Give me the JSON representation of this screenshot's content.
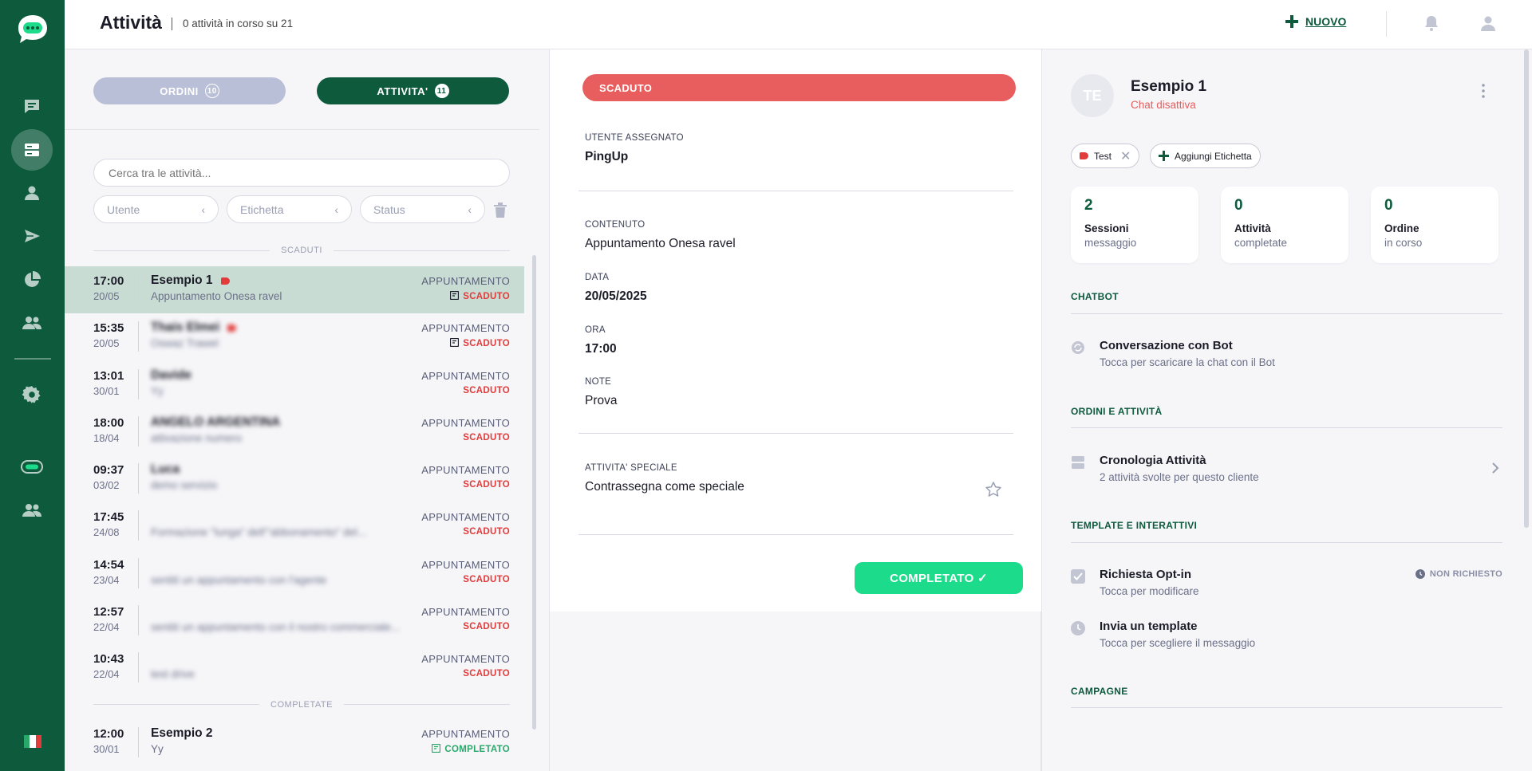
{
  "header": {
    "title": "Attività",
    "subtitle": "0 attività in corso su 21",
    "new_label": "NUOVO"
  },
  "sidebar": {
    "items": [
      {
        "icon": "chat-icon"
      },
      {
        "icon": "list-icon",
        "active": true
      },
      {
        "icon": "user-icon"
      },
      {
        "icon": "send-icon"
      },
      {
        "icon": "pie-chart-icon"
      },
      {
        "icon": "users-icon"
      },
      {
        "icon": "settings-icon"
      },
      {
        "icon": "chatbot-icon"
      },
      {
        "icon": "team-icon"
      }
    ],
    "flag": "italy-flag"
  },
  "left": {
    "tabs": {
      "orders_label": "ORDINI",
      "orders_count": "10",
      "activities_label": "ATTIVITA'",
      "activities_count": "11"
    },
    "search_placeholder": "Cerca tra le attività...",
    "filters": {
      "user": "Utente",
      "label": "Etichetta",
      "status": "Status"
    },
    "section_expired": "SCADUTI",
    "section_completed": "COMPLETATE",
    "expired_rows": [
      {
        "time": "17:00",
        "date": "20/05",
        "name": "Esempio 1",
        "desc": "Appuntamento Onesa ravel",
        "type": "APPUNTAMENTO",
        "status": "SCADUTO",
        "has_tag": true,
        "has_note": true,
        "blurred": false
      },
      {
        "time": "15:35",
        "date": "20/05",
        "name": "Thais Elmei",
        "desc": "Oswaz Trawel",
        "type": "APPUNTAMENTO",
        "status": "SCADUTO",
        "has_tag": true,
        "has_note": true,
        "blurred": true
      },
      {
        "time": "13:01",
        "date": "30/01",
        "name": "Davide",
        "desc": "Yy",
        "type": "APPUNTAMENTO",
        "status": "SCADUTO",
        "has_tag": false,
        "has_note": false,
        "blurred": true
      },
      {
        "time": "18:00",
        "date": "18/04",
        "name": "ANGELO ARGENTINA",
        "desc": "attivazione numero",
        "type": "APPUNTAMENTO",
        "status": "SCADUTO",
        "has_tag": false,
        "has_note": false,
        "blurred": true
      },
      {
        "time": "09:37",
        "date": "03/02",
        "name": "Luca",
        "desc": "demo servizio",
        "type": "APPUNTAMENTO",
        "status": "SCADUTO",
        "has_tag": false,
        "has_note": false,
        "blurred": true
      },
      {
        "time": "17:45",
        "date": "24/08",
        "name": "",
        "desc": "Formazione \"lunga\" dell'\"abbonamento\" del...",
        "type": "APPUNTAMENTO",
        "status": "SCADUTO",
        "has_tag": false,
        "has_note": false,
        "blurred": true
      },
      {
        "time": "14:54",
        "date": "23/04",
        "name": "",
        "desc": "sentiti un appuntamento con l'agente",
        "type": "APPUNTAMENTO",
        "status": "SCADUTO",
        "has_tag": false,
        "has_note": false,
        "blurred": true
      },
      {
        "time": "12:57",
        "date": "22/04",
        "name": "",
        "desc": "sentiti un appuntamento con il nostro commerciale...",
        "type": "APPUNTAMENTO",
        "status": "SCADUTO",
        "has_tag": false,
        "has_note": false,
        "blurred": true
      },
      {
        "time": "10:43",
        "date": "22/04",
        "name": "",
        "desc": "test drive",
        "type": "APPUNTAMENTO",
        "status": "SCADUTO",
        "has_tag": false,
        "has_note": false,
        "blurred": true
      }
    ],
    "completed_rows": [
      {
        "time": "12:00",
        "date": "30/01",
        "name": "Esempio 2",
        "desc": "Yy",
        "type": "APPUNTAMENTO",
        "status": "COMPLETATO",
        "has_note": true
      }
    ]
  },
  "detail": {
    "status_bar": "SCADUTO",
    "assigned_label": "UTENTE ASSEGNATO",
    "assigned_value": "PingUp",
    "content_label": "CONTENUTO",
    "content_value": "Appuntamento Onesa ravel",
    "date_label": "DATA",
    "date_value": "20/05/2025",
    "time_label": "ORA",
    "time_value": "17:00",
    "notes_label": "NOTE",
    "notes_value": "Prova",
    "special_label": "ATTIVITA' SPECIALE",
    "special_value": "Contrassegna come speciale",
    "complete_label": "COMPLETATO ✓"
  },
  "customer": {
    "initials": "TE",
    "name": "Esempio 1",
    "chat_status": "Chat disattiva",
    "tag_label": "Test",
    "add_tag_label": "Aggiungi Etichetta",
    "stats": [
      {
        "num": "2",
        "l1": "Sessioni",
        "l2": "messaggio"
      },
      {
        "num": "0",
        "l1": "Attività",
        "l2": "completate"
      },
      {
        "num": "0",
        "l1": "Ordine",
        "l2": "in corso"
      }
    ],
    "sections": {
      "chatbot": "CHATBOT",
      "orders": "ORDINI E ATTIVITÀ",
      "templates": "TEMPLATE E INTERATTIVI",
      "campaigns": "CAMPAGNE"
    },
    "bot_title": "Conversazione con Bot",
    "bot_sub": "Tocca per scaricare la chat con il Bot",
    "history_title": "Cronologia Attività",
    "history_sub": "2 attività svolte per questo cliente",
    "optin_title": "Richiesta Opt-in",
    "optin_sub": "Tocca per modificare",
    "optin_badge": "NON RICHIESTO",
    "template_title": "Invia un template",
    "template_sub": "Tocca per scegliere il messaggio"
  },
  "colors": {
    "brand": "#0d5a3d",
    "expired": "#e85d5d",
    "complete": "#1cdb8a"
  }
}
